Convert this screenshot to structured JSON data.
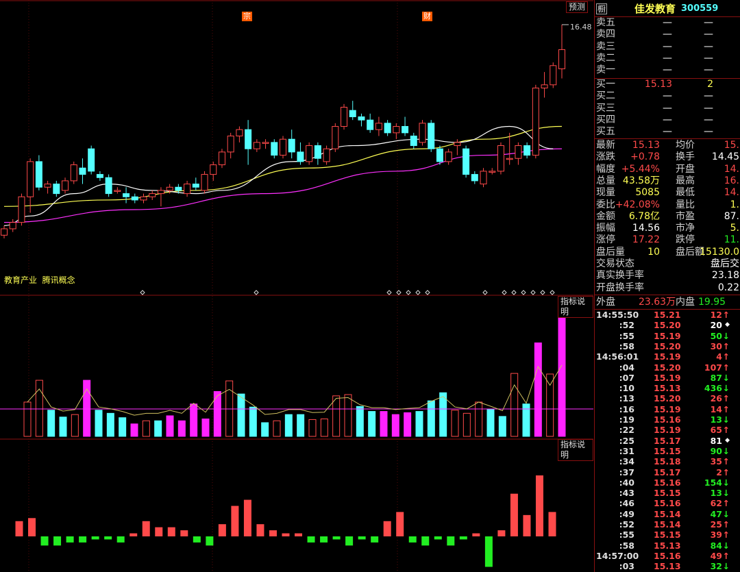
{
  "header": {
    "stock_name": "佳发教育",
    "stock_code": "300559",
    "icon_label": "橱"
  },
  "buttons": {
    "forecast": "预测",
    "indicator_desc_1": "指标说明",
    "indicator_desc_2": "指标说明"
  },
  "markers": {
    "tag1": "宗",
    "tag2": "财"
  },
  "concepts": "教育产业  腾讯概念",
  "price_label": "16.48",
  "colors": {
    "up": "#ff4a4a",
    "down": "#54ffff",
    "ma5": "#ffffff",
    "ma10": "#ffff54",
    "ma20": "#ff30ff",
    "volbar": "#ff22ff",
    "negbar": "#22ee22"
  },
  "orderbook": {
    "sell": [
      {
        "label": "卖五",
        "price": "—",
        "vol": "—"
      },
      {
        "label": "卖四",
        "price": "—",
        "vol": "—"
      },
      {
        "label": "卖三",
        "price": "—",
        "vol": "—"
      },
      {
        "label": "卖二",
        "price": "—",
        "vol": "—"
      },
      {
        "label": "卖一",
        "price": "—",
        "vol": "—"
      }
    ],
    "buy": [
      {
        "label": "买一",
        "price": "15.13",
        "vol": "2"
      },
      {
        "label": "买二",
        "price": "—",
        "vol": "—"
      },
      {
        "label": "买三",
        "price": "—",
        "vol": "—"
      },
      {
        "label": "买四",
        "price": "—",
        "vol": "—"
      },
      {
        "label": "买五",
        "price": "—",
        "vol": "—"
      }
    ]
  },
  "quote": [
    {
      "l1": "最新",
      "v1": "15.13",
      "c1": "red",
      "l2": "均价",
      "v2": "15.",
      "c2": "red"
    },
    {
      "l1": "涨跌",
      "v1": "+0.78",
      "c1": "red",
      "l2": "换手",
      "v2": "14.45",
      "c2": "white"
    },
    {
      "l1": "幅度",
      "v1": "+5.44%",
      "c1": "red",
      "l2": "开盘",
      "v2": "14.",
      "c2": "red"
    },
    {
      "l1": "总量",
      "v1": "43.58万",
      "c1": "yel",
      "l2": "最高",
      "v2": "16.",
      "c2": "red"
    },
    {
      "l1": "现量",
      "v1": "5085",
      "c1": "yel",
      "l2": "最低",
      "v2": "14.",
      "c2": "red"
    },
    {
      "l1": "委比",
      "v1": "+42.08%",
      "c1": "red",
      "l2": "量比",
      "v2": "1.",
      "c2": "yel"
    },
    {
      "l1": "金额",
      "v1": "6.78亿",
      "c1": "yel",
      "l2": "市盈",
      "v2": "87.",
      "c2": "white"
    },
    {
      "l1": "振幅",
      "v1": "14.56",
      "c1": "white",
      "l2": "市净",
      "v2": "5.",
      "c2": "yel"
    },
    {
      "l1": "涨停",
      "v1": "17.22",
      "c1": "red",
      "l2": "跌停",
      "v2": "11.",
      "c2": "green"
    },
    {
      "l1": "盘后量",
      "v1": "10",
      "c1": "yel",
      "l2": "盘后额",
      "v2": "15130.0",
      "c2": "yel"
    }
  ],
  "status": [
    {
      "label": "交易状态",
      "value": "盘后交"
    },
    {
      "label": "真实换手率",
      "value": "23.18"
    },
    {
      "label": "开盘换手率",
      "value": "0.22"
    }
  ],
  "flow": {
    "outer_label": "外盘",
    "outer_value": "23.63万",
    "inner_label": "内盘",
    "inner_value": "19.95"
  },
  "ticks": [
    {
      "time": "14:55:50",
      "price": "15.21",
      "vol": "12",
      "dir": "up"
    },
    {
      "time": ":52",
      "price": "15.20",
      "vol": "20",
      "dir": "neutral"
    },
    {
      "time": ":55",
      "price": "15.19",
      "vol": "50",
      "dir": "down"
    },
    {
      "time": ":58",
      "price": "15.20",
      "vol": "30",
      "dir": "up"
    },
    {
      "time": "14:56:01",
      "price": "15.19",
      "vol": "4",
      "dir": "up"
    },
    {
      "time": ":04",
      "price": "15.20",
      "vol": "107",
      "dir": "up"
    },
    {
      "time": ":07",
      "price": "15.19",
      "vol": "87",
      "dir": "down"
    },
    {
      "time": ":10",
      "price": "15.13",
      "vol": "436",
      "dir": "down"
    },
    {
      "time": ":13",
      "price": "15.20",
      "vol": "26",
      "dir": "up"
    },
    {
      "time": ":16",
      "price": "15.19",
      "vol": "14",
      "dir": "up"
    },
    {
      "time": ":19",
      "price": "15.16",
      "vol": "13",
      "dir": "down"
    },
    {
      "time": ":22",
      "price": "15.19",
      "vol": "65",
      "dir": "up"
    },
    {
      "time": ":25",
      "price": "15.17",
      "vol": "81",
      "dir": "neutral"
    },
    {
      "time": ":31",
      "price": "15.15",
      "vol": "90",
      "dir": "down"
    },
    {
      "time": ":34",
      "price": "15.18",
      "vol": "35",
      "dir": "up"
    },
    {
      "time": ":37",
      "price": "15.17",
      "vol": "2",
      "dir": "up"
    },
    {
      "time": ":40",
      "price": "15.16",
      "vol": "154",
      "dir": "down"
    },
    {
      "time": ":43",
      "price": "15.15",
      "vol": "13",
      "dir": "down"
    },
    {
      "time": ":46",
      "price": "15.16",
      "vol": "62",
      "dir": "up"
    },
    {
      "time": ":49",
      "price": "15.14",
      "vol": "47",
      "dir": "down"
    },
    {
      "time": ":52",
      "price": "15.14",
      "vol": "25",
      "dir": "up"
    },
    {
      "time": ":55",
      "price": "15.15",
      "vol": "39",
      "dir": "up"
    },
    {
      "time": ":58",
      "price": "15.13",
      "vol": "84",
      "dir": "down"
    },
    {
      "time": "14:57:00",
      "price": "15.16",
      "vol": "49",
      "dir": "up"
    },
    {
      "time": ":03",
      "price": "15.13",
      "vol": "32",
      "dir": "down"
    }
  ],
  "chart_data": {
    "type": "candlestick",
    "price_label": "16.48",
    "candles": [
      [
        9.9,
        10.2,
        9.8,
        10.1
      ],
      [
        10.1,
        10.4,
        10.0,
        10.3
      ],
      [
        10.3,
        11.2,
        10.2,
        11.1
      ],
      [
        11.1,
        12.3,
        10.6,
        12.2
      ],
      [
        12.2,
        12.4,
        11.3,
        11.4
      ],
      [
        11.4,
        11.6,
        11.2,
        11.5
      ],
      [
        11.5,
        11.6,
        11.1,
        11.2
      ],
      [
        11.3,
        11.7,
        11.2,
        11.6
      ],
      [
        11.6,
        12.2,
        11.5,
        12.1
      ],
      [
        12.0,
        12.3,
        11.5,
        11.8
      ],
      [
        12.6,
        12.7,
        11.8,
        11.9
      ],
      [
        11.8,
        11.9,
        11.6,
        11.7
      ],
      [
        11.7,
        11.8,
        11.1,
        11.2
      ],
      [
        11.3,
        11.4,
        11.2,
        11.3
      ],
      [
        11.2,
        11.4,
        10.9,
        11.1
      ],
      [
        11.1,
        11.2,
        10.9,
        11.0
      ],
      [
        11.0,
        11.2,
        10.9,
        11.1
      ],
      [
        11.1,
        11.3,
        11.0,
        11.2
      ],
      [
        11.2,
        11.4,
        10.8,
        11.3
      ],
      [
        11.3,
        11.5,
        11.2,
        11.4
      ],
      [
        11.4,
        11.5,
        11.2,
        11.3
      ],
      [
        11.2,
        11.6,
        11.1,
        11.5
      ],
      [
        11.5,
        11.7,
        11.3,
        11.4
      ],
      [
        11.3,
        11.9,
        11.2,
        11.8
      ],
      [
        11.8,
        12.2,
        11.6,
        12.1
      ],
      [
        12.1,
        12.6,
        12.0,
        12.5
      ],
      [
        12.5,
        13.1,
        12.3,
        13.0
      ],
      [
        13.0,
        13.3,
        12.8,
        13.2
      ],
      [
        13.2,
        13.5,
        12.1,
        12.6
      ],
      [
        12.6,
        12.9,
        12.5,
        12.8
      ],
      [
        12.8,
        12.9,
        12.6,
        12.8
      ],
      [
        12.8,
        12.9,
        12.3,
        12.4
      ],
      [
        12.4,
        13.0,
        12.3,
        12.9
      ],
      [
        12.9,
        13.2,
        12.3,
        12.5
      ],
      [
        12.5,
        12.8,
        12.1,
        12.2
      ],
      [
        12.2,
        12.8,
        12.1,
        12.7
      ],
      [
        12.7,
        12.8,
        12.1,
        12.3
      ],
      [
        12.2,
        12.7,
        12.1,
        12.6
      ],
      [
        12.6,
        13.4,
        12.5,
        13.3
      ],
      [
        13.3,
        14.0,
        13.2,
        13.9
      ],
      [
        13.8,
        14.1,
        13.5,
        13.6
      ],
      [
        13.6,
        13.7,
        13.3,
        13.5
      ],
      [
        13.5,
        13.7,
        13.1,
        13.2
      ],
      [
        13.2,
        13.6,
        13.0,
        13.4
      ],
      [
        13.4,
        13.5,
        13.0,
        13.1
      ],
      [
        13.1,
        13.4,
        12.9,
        13.3
      ],
      [
        13.3,
        13.6,
        13.0,
        13.1
      ],
      [
        13.0,
        13.1,
        12.6,
        12.7
      ],
      [
        12.8,
        13.5,
        12.7,
        13.4
      ],
      [
        13.4,
        13.5,
        12.5,
        12.6
      ],
      [
        12.6,
        12.7,
        12.1,
        12.2
      ],
      [
        12.2,
        12.6,
        12.1,
        12.5
      ],
      [
        12.7,
        12.9,
        12.4,
        12.8
      ],
      [
        12.6,
        12.7,
        11.7,
        11.8
      ],
      [
        11.8,
        11.9,
        11.5,
        11.6
      ],
      [
        11.5,
        12.0,
        11.4,
        11.9
      ],
      [
        11.9,
        12.0,
        11.8,
        11.9
      ],
      [
        11.9,
        12.8,
        11.8,
        12.7
      ],
      [
        12.3,
        13.1,
        12.1,
        12.3
      ],
      [
        12.3,
        12.8,
        12.1,
        12.7
      ],
      [
        12.7,
        12.8,
        12.3,
        12.4
      ],
      [
        12.4,
        14.6,
        12.3,
        14.5
      ],
      [
        14.5,
        15.0,
        14.2,
        14.6
      ],
      [
        14.6,
        15.3,
        14.5,
        15.2
      ],
      [
        15.1,
        16.48,
        14.8,
        15.7
      ]
    ],
    "volume": [
      [
        55,
        "up"
      ],
      [
        90,
        "up"
      ],
      [
        42,
        "down"
      ],
      [
        31,
        "down"
      ],
      [
        35,
        "up"
      ],
      [
        90,
        "mag"
      ],
      [
        42,
        "down"
      ],
      [
        37,
        "down"
      ],
      [
        30,
        "down"
      ],
      [
        20,
        "mag"
      ],
      [
        25,
        "up"
      ],
      [
        25,
        "down"
      ],
      [
        33,
        "mag"
      ],
      [
        25,
        "mag"
      ],
      [
        52,
        "mag"
      ],
      [
        28,
        "mag"
      ],
      [
        72,
        "mag"
      ],
      [
        89,
        "up"
      ],
      [
        68,
        "down"
      ],
      [
        47,
        "down"
      ],
      [
        22,
        "down"
      ],
      [
        25,
        "up"
      ],
      [
        35,
        "down"
      ],
      [
        35,
        "down"
      ],
      [
        27,
        "up"
      ],
      [
        28,
        "up"
      ],
      [
        65,
        "up"
      ],
      [
        67,
        "up"
      ],
      [
        48,
        "down"
      ],
      [
        40,
        "down"
      ],
      [
        40,
        "mag"
      ],
      [
        35,
        "mag"
      ],
      [
        38,
        "mag"
      ],
      [
        40,
        "down"
      ],
      [
        57,
        "down"
      ],
      [
        70,
        "down"
      ],
      [
        42,
        "up"
      ],
      [
        37,
        "up"
      ],
      [
        55,
        "up"
      ],
      [
        44,
        "down"
      ],
      [
        32,
        "down"
      ],
      [
        101,
        "up"
      ],
      [
        52,
        "down"
      ],
      [
        150,
        "mag"
      ],
      [
        100,
        "up"
      ],
      [
        200,
        "mag"
      ]
    ],
    "macd": [
      [
        5,
        "r"
      ],
      [
        6,
        "r"
      ],
      [
        -3,
        "g"
      ],
      [
        -3,
        "g"
      ],
      [
        -2,
        "g"
      ],
      [
        -2,
        "g"
      ],
      [
        -1,
        "g"
      ],
      [
        -1,
        "g"
      ],
      [
        -2,
        "g"
      ],
      [
        1,
        "r"
      ],
      [
        5,
        "r"
      ],
      [
        3,
        "r"
      ],
      [
        3,
        "r"
      ],
      [
        2,
        "r"
      ],
      [
        -2,
        "g"
      ],
      [
        -3,
        "g"
      ],
      [
        4,
        "r"
      ],
      [
        10,
        "r"
      ],
      [
        12,
        "r"
      ],
      [
        4,
        "r"
      ],
      [
        2,
        "r"
      ],
      [
        1,
        "r"
      ],
      [
        1,
        "r"
      ],
      [
        -2,
        "g"
      ],
      [
        -2,
        "g"
      ],
      [
        -1,
        "g"
      ],
      [
        -3,
        "g"
      ],
      [
        -1,
        "g"
      ],
      [
        -2,
        "g"
      ],
      [
        5,
        "r"
      ],
      [
        8,
        "r"
      ],
      [
        -2,
        "g"
      ],
      [
        -3,
        "g"
      ],
      [
        -1,
        "g"
      ],
      [
        -3,
        "g"
      ],
      [
        -1,
        "g"
      ],
      [
        1,
        "r"
      ],
      [
        -10,
        "g"
      ],
      [
        2,
        "r"
      ],
      [
        14,
        "r"
      ],
      [
        7,
        "r"
      ],
      [
        20,
        "r"
      ],
      [
        8,
        "r"
      ]
    ],
    "ma5": [
      [
        10.2,
        0
      ],
      [
        10.5,
        3
      ],
      [
        11.2,
        8
      ],
      [
        11.5,
        12
      ],
      [
        11.3,
        17
      ],
      [
        11.2,
        22
      ],
      [
        11.3,
        25
      ],
      [
        12.2,
        33
      ],
      [
        12.7,
        40
      ],
      [
        12.9,
        48
      ],
      [
        12.8,
        52
      ],
      [
        13.3,
        58
      ],
      [
        12.6,
        63
      ]
    ],
    "ma10": [
      [
        10.8,
        0
      ],
      [
        11.0,
        12
      ],
      [
        11.3,
        22
      ],
      [
        12.0,
        35
      ],
      [
        12.6,
        48
      ],
      [
        12.9,
        55
      ],
      [
        13.3,
        64
      ]
    ],
    "ma20": [
      [
        10.3,
        0
      ],
      [
        10.7,
        15
      ],
      [
        11.2,
        30
      ],
      [
        11.9,
        45
      ],
      [
        12.4,
        55
      ],
      [
        12.6,
        64
      ]
    ]
  }
}
